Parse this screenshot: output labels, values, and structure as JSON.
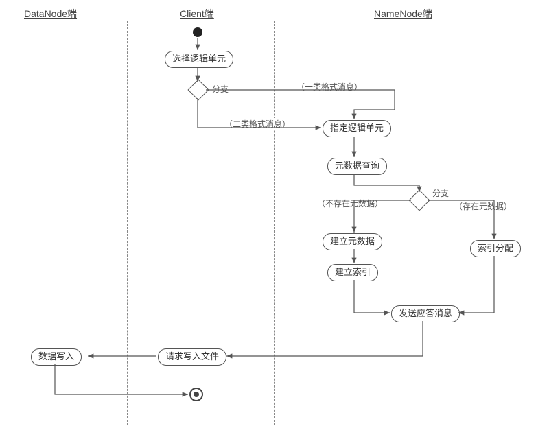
{
  "chart_data": {
    "type": "activity-diagram",
    "swimlanes": [
      "DataNode端",
      "Client端",
      "NameNode端"
    ],
    "nodes": [
      {
        "id": "start",
        "type": "initial",
        "lane": "Client端"
      },
      {
        "id": "select_unit",
        "type": "activity",
        "lane": "Client端",
        "label": "选择逻辑单元"
      },
      {
        "id": "branch1",
        "type": "decision",
        "lane": "Client端",
        "label": "分支"
      },
      {
        "id": "specify_unit",
        "type": "activity",
        "lane": "NameNode端",
        "label": "指定逻辑单元"
      },
      {
        "id": "meta_query",
        "type": "activity",
        "lane": "NameNode端",
        "label": "元数据查询"
      },
      {
        "id": "branch2",
        "type": "decision",
        "lane": "NameNode端",
        "label": "分支"
      },
      {
        "id": "create_meta",
        "type": "activity",
        "lane": "NameNode端",
        "label": "建立元数据"
      },
      {
        "id": "create_index",
        "type": "activity",
        "lane": "NameNode端",
        "label": "建立索引"
      },
      {
        "id": "index_alloc",
        "type": "activity",
        "lane": "NameNode端",
        "label": "索引分配"
      },
      {
        "id": "send_resp",
        "type": "activity",
        "lane": "NameNode端",
        "label": "发送应答消息"
      },
      {
        "id": "req_write",
        "type": "activity",
        "lane": "Client端",
        "label": "请求写入文件"
      },
      {
        "id": "data_write",
        "type": "activity",
        "lane": "DataNode端",
        "label": "数据写入"
      },
      {
        "id": "end",
        "type": "final",
        "lane": "Client端"
      }
    ],
    "edges": [
      {
        "from": "start",
        "to": "select_unit"
      },
      {
        "from": "select_unit",
        "to": "branch1"
      },
      {
        "from": "branch1",
        "to": "specify_unit",
        "guard": "（一类格式消息）",
        "via": "top"
      },
      {
        "from": "branch1",
        "to": "specify_unit",
        "guard": "（二类格式消息）",
        "via": "bottom"
      },
      {
        "from": "specify_unit",
        "to": "meta_query"
      },
      {
        "from": "meta_query",
        "to": "branch2"
      },
      {
        "from": "branch2",
        "to": "create_meta",
        "guard": "（不存在元数据）"
      },
      {
        "from": "branch2",
        "to": "index_alloc",
        "guard": "（存在元数据）"
      },
      {
        "from": "create_meta",
        "to": "create_index"
      },
      {
        "from": "create_index",
        "to": "send_resp"
      },
      {
        "from": "index_alloc",
        "to": "send_resp"
      },
      {
        "from": "send_resp",
        "to": "req_write"
      },
      {
        "from": "req_write",
        "to": "data_write"
      },
      {
        "from": "data_write",
        "to": "end"
      }
    ]
  },
  "headers": {
    "datanode": "DataNode端",
    "client": "Client端",
    "namenode": "NameNode端"
  },
  "labels": {
    "select_unit": "选择逻辑单元",
    "branch1": "分支",
    "msg_type1": "（一类格式消息）",
    "msg_type2": "（二类格式消息）",
    "specify_unit": "指定逻辑单元",
    "meta_query": "元数据查询",
    "branch2": "分支",
    "no_meta": "（不存在元数据）",
    "has_meta": "（存在元数据）",
    "create_meta": "建立元数据",
    "create_index": "建立索引",
    "index_alloc": "索引分配",
    "send_resp": "发送应答消息",
    "req_write": "请求写入文件",
    "data_write": "数据写入"
  }
}
